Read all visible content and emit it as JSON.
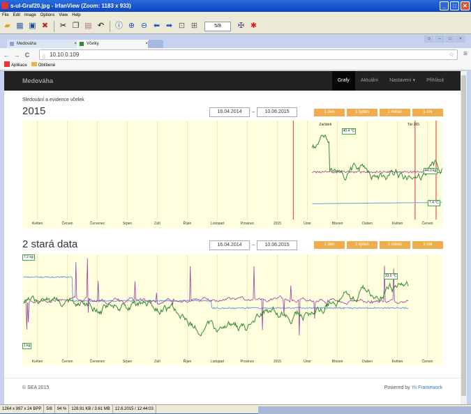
{
  "irfanview": {
    "title": "s-ul-Graf20.jpg - IrfanView (Zoom: 1183 x 933)",
    "menu": [
      "File",
      "Edit",
      "Image",
      "Options",
      "View",
      "Help"
    ],
    "page_counter": "5/8",
    "status": [
      "1264 x 997 x 24 BPP",
      "5/8",
      "94 %",
      "128.91 KB / 3.61 MB",
      "12.6.2015 / 12:44:03"
    ]
  },
  "browser": {
    "tabs": [
      {
        "label": "Medováha"
      },
      {
        "label": "Včelky"
      }
    ],
    "url": "10.10.0.109",
    "bookmarks": [
      "Aplikace",
      "Oblíbené"
    ]
  },
  "site": {
    "brand": "Medováha",
    "nav": [
      "Grafy",
      "Aktuální",
      "Nastavení ▾",
      "Přihlásit"
    ],
    "subtitle": "Sledování a evidence včelek",
    "range_buttons": [
      "1 den",
      "1 týden",
      "1 měsíc",
      "1 rok"
    ],
    "footer_left": "© SEA 2015",
    "footer_powered": "Powered by",
    "footer_link": "Yii Framework"
  },
  "chart_data": [
    {
      "type": "line",
      "title": "2015",
      "date_from": "16.04.2014",
      "date_to": "10.06.2015",
      "x_ticks": [
        "Květen",
        "Červen",
        "Červenec",
        "Srpen",
        "Září",
        "Říjen",
        "Listopad",
        "Prosinec",
        "2015",
        "Únor",
        "Březen",
        "Duben",
        "Květen",
        "Červen"
      ],
      "annotations": [
        "Začátek",
        "40.4 °C",
        "44.0 kg",
        "7.4 °C",
        "Tár 265"
      ],
      "markers": [
        {
          "type": "vertical",
          "color": "#e03030",
          "x": 0.645
        },
        {
          "type": "vertical",
          "color": "#e03030",
          "x": 0.935
        },
        {
          "type": "vertical",
          "color": "#e03030",
          "x": 0.985
        }
      ]
    },
    {
      "type": "line",
      "title": "2 stará data",
      "date_from": "16.04.2014",
      "date_to": "10.06.2015",
      "x_ticks": [
        "Květen",
        "Červen",
        "Červenec",
        "Srpen",
        "Září",
        "Říjen",
        "Listopad",
        "Prosinec",
        "2015",
        "Únor",
        "Březen",
        "Duben",
        "Květen",
        "Červen"
      ],
      "annotations": [
        "7.2 kg",
        "33.0 °C",
        "1 kg"
      ]
    }
  ]
}
